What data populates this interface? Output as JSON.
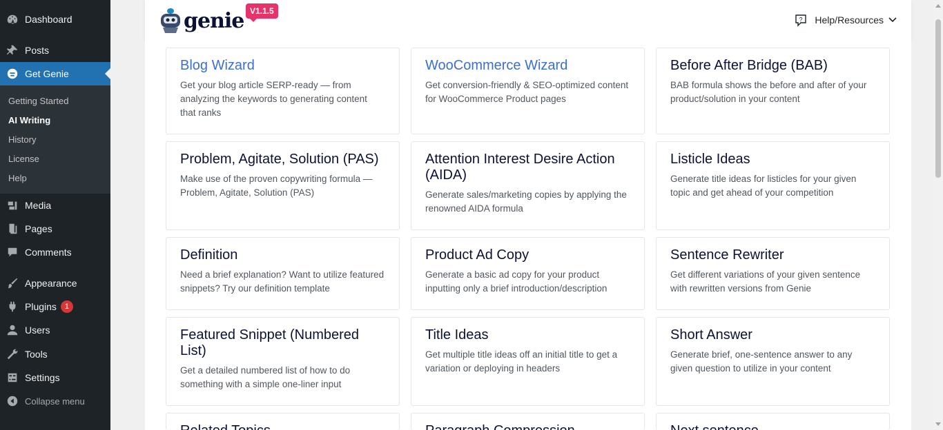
{
  "sidebar": {
    "items": [
      {
        "label": "Dashboard",
        "icon": "dashboard-icon"
      },
      {
        "label": "Posts",
        "icon": "pin-icon"
      },
      {
        "label": "Get Genie",
        "icon": "genie-icon"
      },
      {
        "label": "Media",
        "icon": "media-icon"
      },
      {
        "label": "Pages",
        "icon": "pages-icon"
      },
      {
        "label": "Comments",
        "icon": "comments-icon"
      },
      {
        "label": "Appearance",
        "icon": "brush-icon"
      },
      {
        "label": "Plugins",
        "icon": "plugin-icon",
        "badge": "1"
      },
      {
        "label": "Users",
        "icon": "users-icon"
      },
      {
        "label": "Tools",
        "icon": "wrench-icon"
      },
      {
        "label": "Settings",
        "icon": "settings-icon"
      }
    ],
    "submenu": [
      "Getting Started",
      "AI Writing",
      "History",
      "License",
      "Help"
    ],
    "collapse_label": "Collapse menu"
  },
  "header": {
    "logo_text": "genie",
    "version": "V1.1.5",
    "help_label": "Help/Resources"
  },
  "cards": [
    {
      "title": "Blog Wizard",
      "desc": "Get your blog article SERP-ready — from analyzing the keywords to generating content that ranks"
    },
    {
      "title": "WooCommerce Wizard",
      "desc": "Get conversion-friendly & SEO-optimized content for WooCommerce Product pages"
    },
    {
      "title": "Before After Bridge (BAB)",
      "desc": "BAB formula shows the before and after of your product/solution in your content"
    },
    {
      "title": "Problem, Agitate, Solution (PAS)",
      "desc": "Make use of the proven copywriting formula — Problem, Agitate, Solution (PAS)"
    },
    {
      "title": "Attention Interest Desire Action (AIDA)",
      "desc": "Generate sales/marketing copies by applying the renowned AIDA formula"
    },
    {
      "title": "Listicle Ideas",
      "desc": "Generate title ideas for listicles for your given topic and get ahead of your competition"
    },
    {
      "title": "Definition",
      "desc": "Need a brief explanation? Want to utilize featured snippets? Try our definition template"
    },
    {
      "title": "Product Ad Copy",
      "desc": "Generate a basic ad copy for your product inputting only a brief introduction/description"
    },
    {
      "title": "Sentence Rewriter",
      "desc": "Get different variations of your given sentence with rewritten versions from Genie"
    },
    {
      "title": "Featured Snippet (Numbered List)",
      "desc": "Get a detailed numbered list of how to do something with a simple one-liner input"
    },
    {
      "title": "Title Ideas",
      "desc": "Get multiple title ideas off an initial title to get a variation or deploying in headers"
    },
    {
      "title": "Short Answer",
      "desc": "Generate brief, one-sentence answer to any given question to utilize in your content"
    },
    {
      "title": "Related Topics",
      "desc": ""
    },
    {
      "title": "Paragraph Compression",
      "desc": ""
    },
    {
      "title": "Next sentence",
      "desc": ""
    }
  ]
}
